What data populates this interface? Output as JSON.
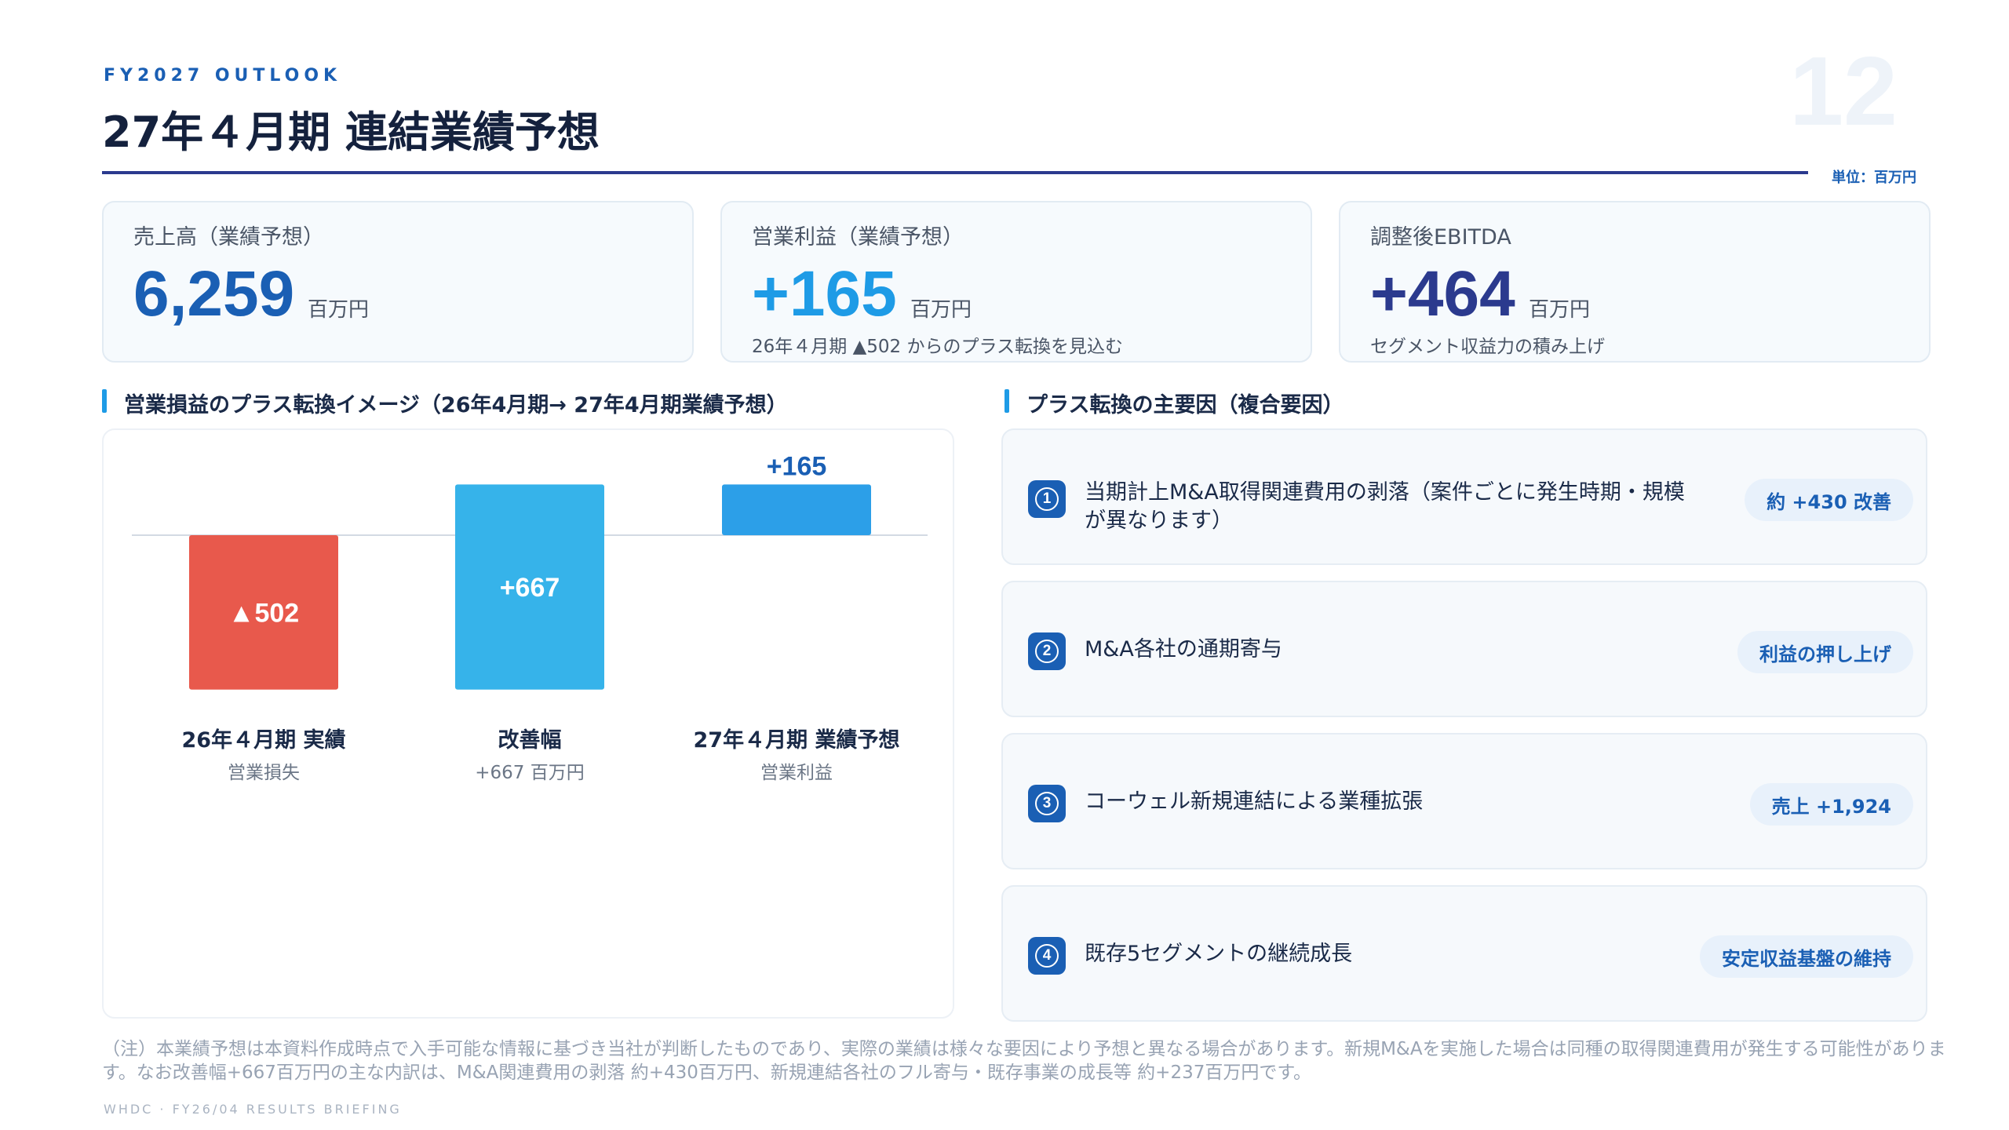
{
  "header": {
    "kicker": "FY2027 OUTLOOK",
    "title": "27年４月期 連結業績予想",
    "page_number": "12",
    "unit": "単位：百万円"
  },
  "kpis": [
    {
      "label": "売上高（業績予想）",
      "value": "6,259",
      "unit": "百万円",
      "sub": "",
      "color": "#1a5fb4"
    },
    {
      "label": "営業利益（業績予想）",
      "value": "+165",
      "unit": "百万円",
      "sub": "26年４月期 ▲502 からのプラス転換を見込む",
      "color": "#1e9be6"
    },
    {
      "label": "調整後EBITDA",
      "value": "+464",
      "unit": "百万円",
      "sub": "セグメント収益力の積み上げ",
      "color": "#2b3a8e"
    }
  ],
  "sections": {
    "chart_title": "営業損益のプラス転換イメージ（26年4月期→ 27年4月期業績予想）",
    "factors_title": "プラス転換の主要因（複合要因）"
  },
  "chart_data": {
    "type": "bar",
    "categories": [
      "26年４月期 実績",
      "改善幅",
      "27年４月期 業績予想"
    ],
    "sublabels": [
      "営業損失",
      "+667 百万円",
      "営業利益"
    ],
    "values": [
      -502,
      667,
      165
    ],
    "data_labels": [
      "▲502",
      "+667",
      "+165"
    ],
    "colors": [
      "#e8594c",
      "#36b3ea",
      "#2c9fe8"
    ],
    "label_colors": [
      "#ffffff",
      "#ffffff",
      "#1a5fb4"
    ]
  },
  "factors": [
    {
      "num": "1",
      "text": "当期計上M&A取得関連費用の剥落（案件ごとに発生時期・規模が異なります）",
      "pill": "約 +430 改善"
    },
    {
      "num": "2",
      "text": "M&A各社の通期寄与",
      "pill": "利益の押し上げ"
    },
    {
      "num": "3",
      "text": "コーウェル新規連結による業種拡張",
      "pill": "売上 +1,924"
    },
    {
      "num": "4",
      "text": "既存5セグメントの継続成長",
      "pill": "安定収益基盤の維持"
    }
  ],
  "note": "（注）本業績予想は本資料作成時点で入手可能な情報に基づき当社が判断したものであり、実際の業績は様々な要因により予想と異なる場合があります。新規M&Aを実施した場合は同種の取得関連費用が発生する可能性があります。なお改善幅+667百万円の主な内訳は、M&A関連費用の剥落 約+430百万円、新規連結各社のフル寄与・既存事業の成長等 約+237百万円です。",
  "footer": "WHDC · FY26/04 RESULTS BRIEFING"
}
